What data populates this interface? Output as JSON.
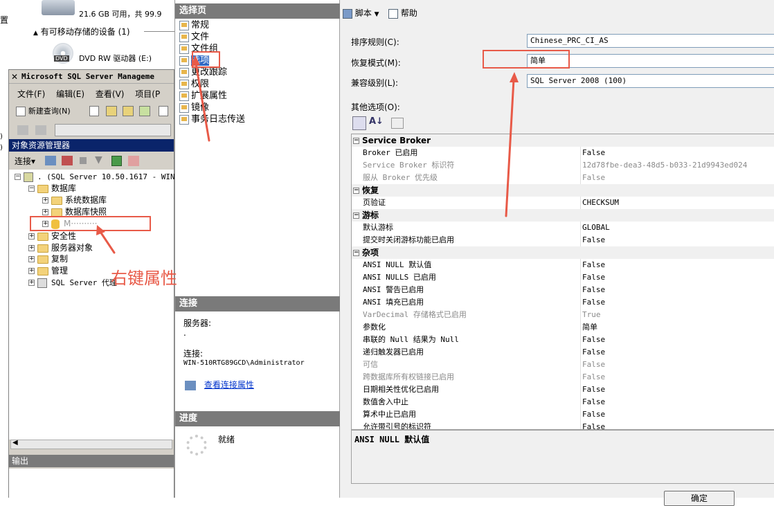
{
  "explorer": {
    "disk_text": "21.6 GB 可用，共 99.9",
    "removable_section": "有可移动存储的设备 (1)",
    "dvd_label": "DVD RW 驱动器 (E:)",
    "dvd_icon_text": "DVD",
    "left_edge_text": "置"
  },
  "ssms": {
    "title": "Microsoft SQL Server Manageme",
    "menu": [
      "文件(F)",
      "编辑(E)",
      "查看(V)",
      "项目(P"
    ],
    "new_query": "新建查询(N)",
    "object_explorer_title": "对象资源管理器",
    "connect_label": "连接",
    "tree": {
      "server": ". (SQL Server 10.50.1617 - WIN",
      "databases": "数据库",
      "system_db": "系统数据库",
      "snapshots": "数据库快照",
      "selected_db": "M··········",
      "security": "安全性",
      "server_objects": "服务器对象",
      "replication": "复制",
      "management": "管理",
      "agent": "SQL Server 代理"
    },
    "output_title": "输出"
  },
  "annotation": {
    "text": "右键属性",
    "color": "#e85a48"
  },
  "dialog": {
    "select_page_title": "选择页",
    "pages": [
      "常规",
      "文件",
      "文件组",
      "选项",
      "更改跟踪",
      "权限",
      "扩展属性",
      "镜像",
      "事务日志传送"
    ],
    "selected_page": "选项",
    "toolbar": {
      "script": "脚本",
      "help": "帮助"
    },
    "connection_title": "连接",
    "server_label": "服务器:",
    "server_value": ".",
    "connection_label": "连接:",
    "connection_value": "WIN-510RTG89GCD\\Administrator",
    "view_conn_link": "查看连接属性",
    "progress_title": "进度",
    "progress_status": "就绪",
    "collation_label": "排序规则(C):",
    "collation_value": "Chinese_PRC_CI_AS",
    "recovery_label": "恢复模式(M):",
    "recovery_value": "简单",
    "compat_label": "兼容级别(L):",
    "compat_value": "SQL Server 2008 (100)",
    "other_options_label": "其他选项(O):",
    "description": "ANSI NULL 默认值",
    "ok_button": "确定"
  },
  "properties": [
    {
      "type": "cat",
      "name": "Service Broker",
      "value": ""
    },
    {
      "type": "row",
      "name": "Broker 已启用",
      "value": "False",
      "dim": false
    },
    {
      "type": "row",
      "name": "Service Broker 标识符",
      "value": "12d78fbe-dea3-48d5-b033-21d9943ed024",
      "dim": true
    },
    {
      "type": "row",
      "name": "服从 Broker 优先级",
      "value": "False",
      "dim": true
    },
    {
      "type": "cat",
      "name": "恢复",
      "value": ""
    },
    {
      "type": "row",
      "name": "页验证",
      "value": "CHECKSUM",
      "dim": false
    },
    {
      "type": "cat",
      "name": "游标",
      "value": ""
    },
    {
      "type": "row",
      "name": "默认游标",
      "value": "GLOBAL",
      "dim": false
    },
    {
      "type": "row",
      "name": "提交时关闭游标功能已启用",
      "value": "False",
      "dim": false
    },
    {
      "type": "cat",
      "name": "杂项",
      "value": ""
    },
    {
      "type": "row",
      "name": "ANSI NULL 默认值",
      "value": "False",
      "dim": false
    },
    {
      "type": "row",
      "name": "ANSI NULLS 已启用",
      "value": "False",
      "dim": false
    },
    {
      "type": "row",
      "name": "ANSI 警告已启用",
      "value": "False",
      "dim": false
    },
    {
      "type": "row",
      "name": "ANSI 填充已启用",
      "value": "False",
      "dim": false
    },
    {
      "type": "row",
      "name": "VarDecimal 存储格式已启用",
      "value": "True",
      "dim": true
    },
    {
      "type": "row",
      "name": "参数化",
      "value": "简单",
      "dim": false
    },
    {
      "type": "row",
      "name": "串联的 Null 结果为 Null",
      "value": "False",
      "dim": false
    },
    {
      "type": "row",
      "name": "递归触发器已启用",
      "value": "False",
      "dim": false
    },
    {
      "type": "row",
      "name": "可信",
      "value": "False",
      "dim": true
    },
    {
      "type": "row",
      "name": "跨数据库所有权链接已启用",
      "value": "False",
      "dim": true
    },
    {
      "type": "row",
      "name": "日期相关性优化已启用",
      "value": "False",
      "dim": false
    },
    {
      "type": "row",
      "name": "数值舍入中止",
      "value": "False",
      "dim": false
    },
    {
      "type": "row",
      "name": "算术中止已启用",
      "value": "False",
      "dim": false
    },
    {
      "type": "row",
      "name": "允许带引号的标识符",
      "value": "False",
      "dim": false
    }
  ]
}
